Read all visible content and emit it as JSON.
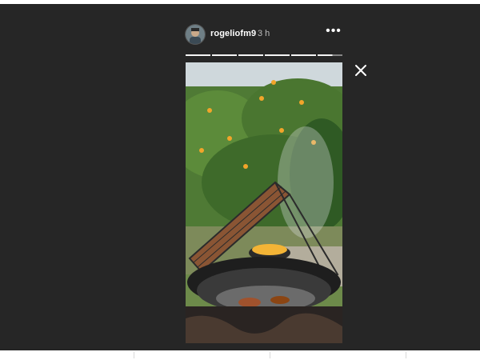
{
  "story": {
    "username": "rogeliofm9",
    "time": "3 h",
    "more_label": "•••",
    "segments_total": 6,
    "segments_viewed": 5,
    "current_segment_progress": 0.6
  },
  "icons": {
    "more": "more-options-icon",
    "close": "close-icon",
    "avatar": "avatar"
  },
  "colors": {
    "viewer_background": "#262626",
    "text_primary": "#ffffff",
    "text_secondary": "#bdbdbd"
  }
}
